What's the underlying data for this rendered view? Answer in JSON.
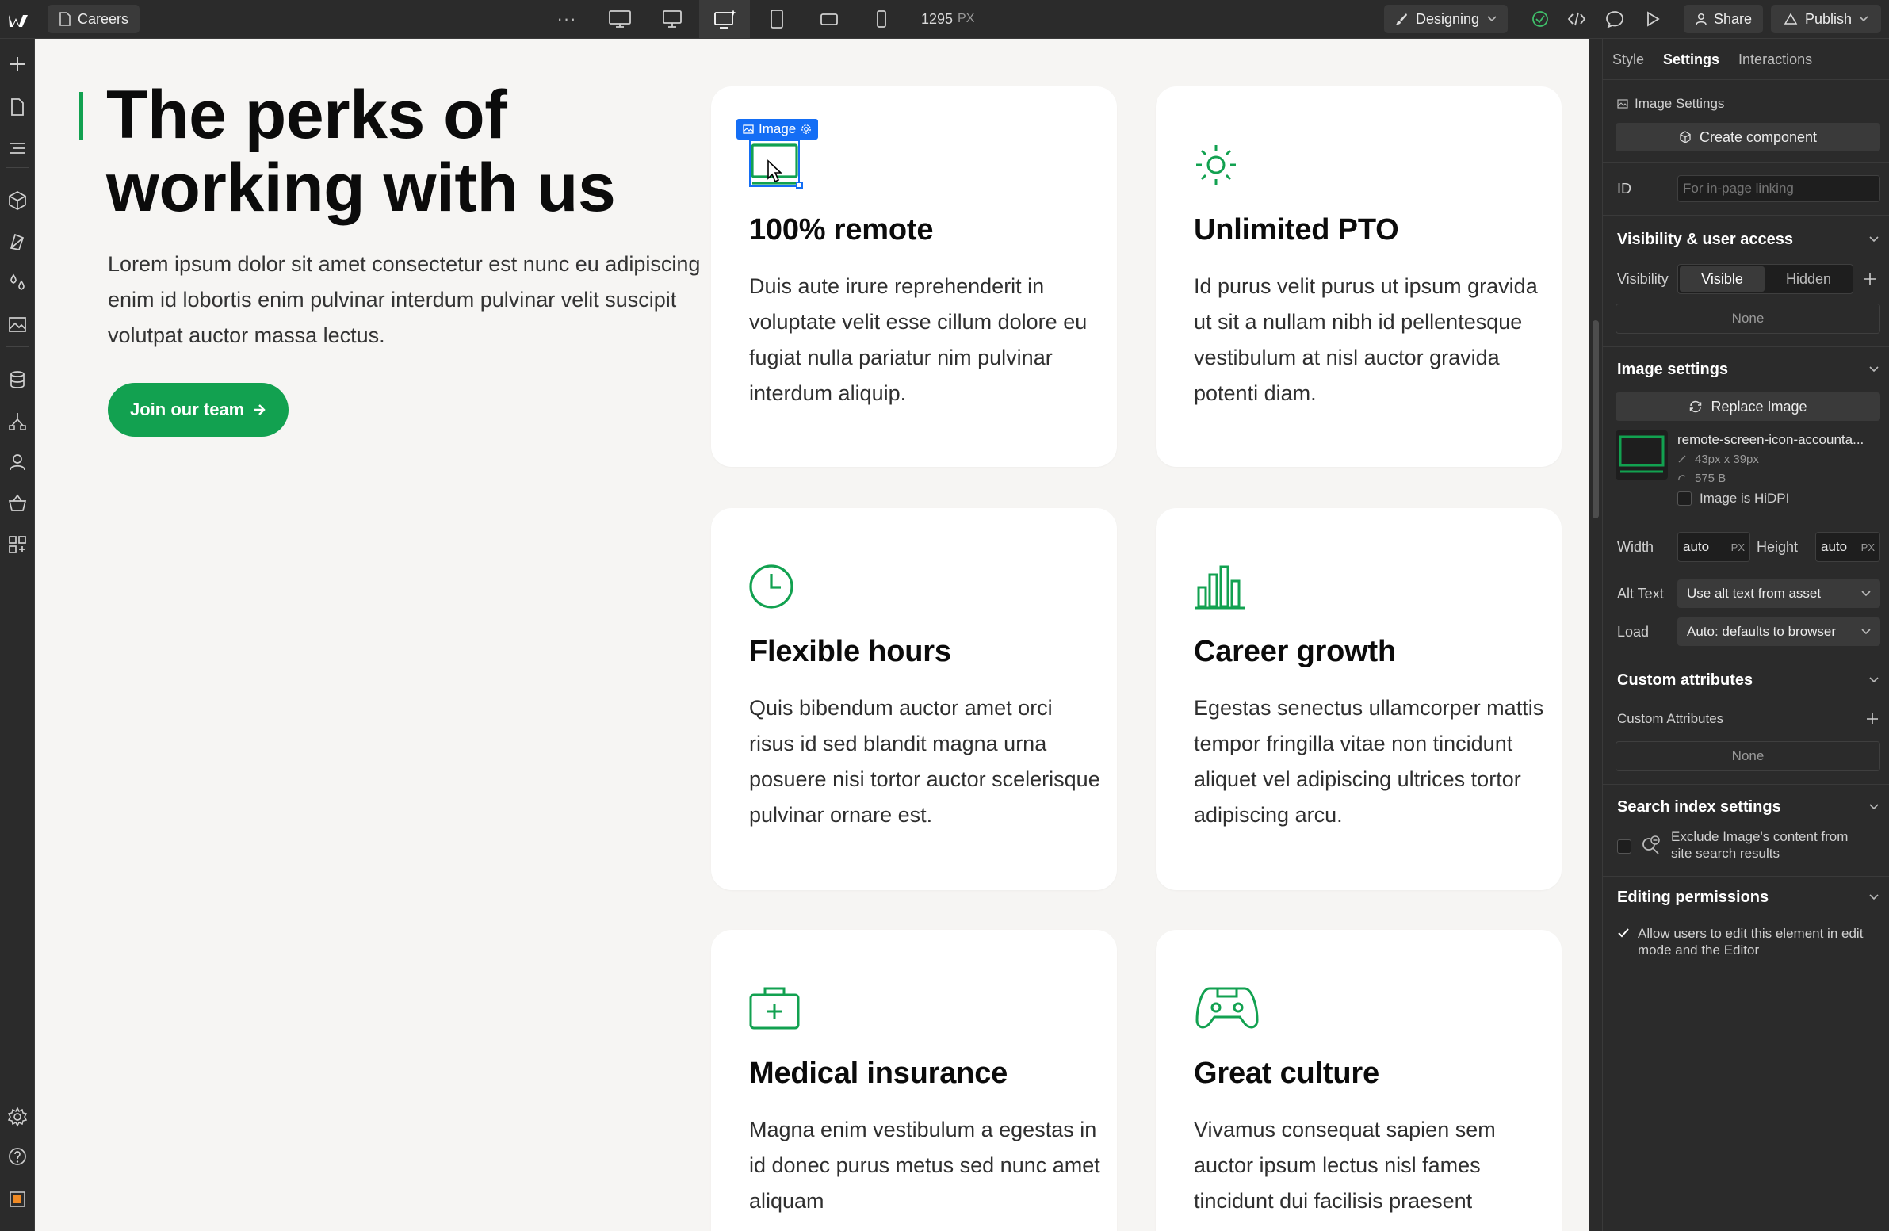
{
  "topbar": {
    "page_name": "Careers",
    "more": "···",
    "width_value": "1295",
    "width_unit": "PX",
    "mode": "Designing",
    "share": "Share",
    "publish": "Publish"
  },
  "colors": {
    "brand_green": "#12a150",
    "selection_blue": "#146ef5",
    "panel_bg": "#2b2b2b",
    "canvas_bg": "#f6f5f3"
  },
  "canvas": {
    "hero_title": "The perks of working with us",
    "hero_desc": "Lorem ipsum dolor sit amet consectetur est nunc eu adipiscing enim id lobortis enim pulvinar interdum pulvinar velit suscipit volutpat auctor massa lectus.",
    "join_button": "Join our team",
    "selection_label": "Image",
    "cards": [
      {
        "icon": "monitor-icon",
        "title": "100% remote",
        "text": "Duis aute irure reprehenderit in voluptate velit esse cillum dolore eu fugiat nulla pariatur nim pulvinar interdum aliquip."
      },
      {
        "icon": "sun-icon",
        "title": "Unlimited PTO",
        "text": "Id purus velit purus ut ipsum gravida ut sit a nullam nibh id pellentesque vestibulum at nisl auctor gravida potenti diam."
      },
      {
        "icon": "clock-icon",
        "title": "Flexible hours",
        "text": "Quis bibendum auctor amet orci risus id sed blandit magna urna posuere nisi tortor auctor scelerisque pulvinar ornare est."
      },
      {
        "icon": "bar-chart-icon",
        "title": "Career growth",
        "text": "Egestas senectus ullamcorper mattis tempor fringilla vitae non tincidunt aliquet vel adipiscing ultrices tortor adipiscing arcu."
      },
      {
        "icon": "medical-kit-icon",
        "title": "Medical insurance",
        "text": "Magna enim vestibulum a egestas in id donec purus metus sed nunc amet aliquam"
      },
      {
        "icon": "gamepad-icon",
        "title": "Great culture",
        "text": "Vivamus consequat sapien sem auctor ipsum lectus nisl fames tincidunt dui facilisis praesent"
      }
    ]
  },
  "panel": {
    "tabs": [
      "Style",
      "Settings",
      "Interactions"
    ],
    "image_settings_label": "Image Settings",
    "create_component": "Create component",
    "id_label": "ID",
    "id_placeholder": "For in-page linking",
    "visibility_section": "Visibility & user access",
    "visibility_label": "Visibility",
    "visible": "Visible",
    "hidden": "Hidden",
    "visibility_none": "None",
    "image_settings_section": "Image settings",
    "replace_image": "Replace Image",
    "file_name": "remote-screen-icon-accounta...",
    "file_dims": "43px x 39px",
    "file_size": "575 B",
    "hidpi_label": "Image is HiDPI",
    "width_label": "Width",
    "width_value": "auto",
    "height_label": "Height",
    "height_value": "auto",
    "unit": "PX",
    "alt_label": "Alt Text",
    "alt_value": "Use alt text from asset",
    "load_label": "Load",
    "load_value": "Auto: defaults to browser",
    "custom_attr_section": "Custom attributes",
    "custom_attr_label": "Custom Attributes",
    "custom_attr_none": "None",
    "search_section": "Search index settings",
    "search_exclude": "Exclude Image's content from site search results",
    "editing_section": "Editing permissions",
    "editing_allow": "Allow users to edit this element in edit mode and the Editor"
  }
}
